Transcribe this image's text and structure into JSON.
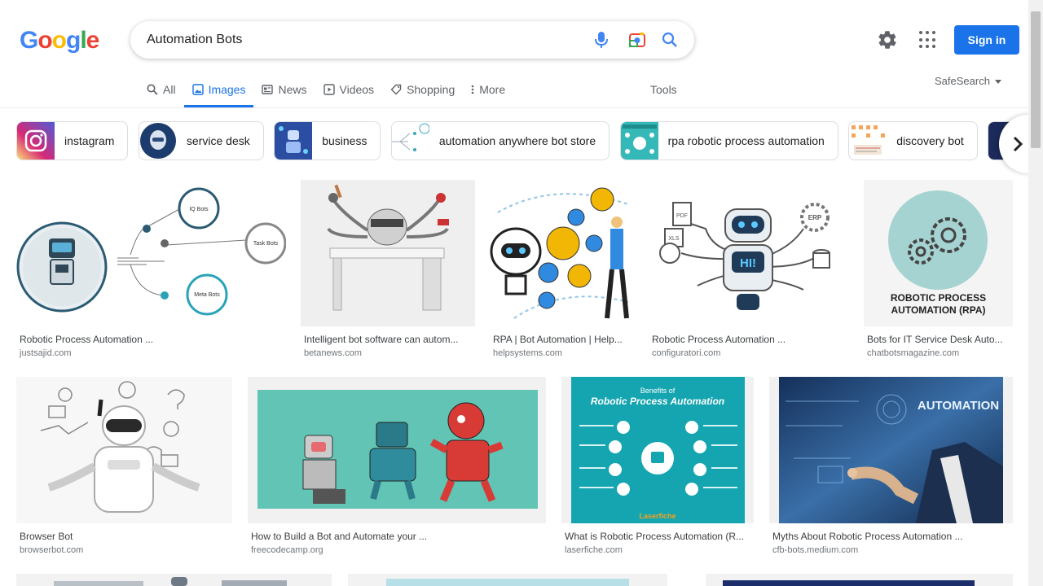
{
  "logo": {
    "letters": [
      "G",
      "o",
      "o",
      "g",
      "l",
      "e"
    ],
    "colors": [
      "#4285F4",
      "#EA4335",
      "#FBBC05",
      "#4285F4",
      "#34A853",
      "#EA4335"
    ]
  },
  "search": {
    "query": "Automation Bots"
  },
  "header": {
    "sign_in": "Sign in"
  },
  "tabs": [
    {
      "label": "All",
      "icon": "search-icon"
    },
    {
      "label": "Images",
      "icon": "image-icon",
      "active": true
    },
    {
      "label": "News",
      "icon": "news-icon"
    },
    {
      "label": "Videos",
      "icon": "video-icon"
    },
    {
      "label": "Shopping",
      "icon": "tag-icon"
    },
    {
      "label": "More",
      "icon": "more-vert-icon"
    }
  ],
  "tools_label": "Tools",
  "safesearch_label": "SafeSearch",
  "chips": [
    {
      "label": "instagram",
      "color": "#c13584"
    },
    {
      "label": "service desk",
      "color": "#1d3c6e"
    },
    {
      "label": "business",
      "color": "#2b4ea3"
    },
    {
      "label": "automation anywhere bot store",
      "color": "#e6f2f8"
    },
    {
      "label": "rpa robotic process automation",
      "color": "#34b8b8"
    },
    {
      "label": "discovery bot",
      "color": "#f4e6d6"
    },
    {
      "label": "",
      "color": "#1b2a5a"
    }
  ],
  "results": [
    {
      "title": "Robotic Process Automation ...",
      "source": "justsajid.com",
      "color": "#ffffff"
    },
    {
      "title": "Intelligent bot software can autom...",
      "source": "betanews.com",
      "color": "#eeeeee"
    },
    {
      "title": "RPA | Bot Automation | Help...",
      "source": "helpsystems.com",
      "color": "#ffffff"
    },
    {
      "title": "Robotic Process Automation ...",
      "source": "configuratori.com",
      "color": "#ffffff"
    },
    {
      "title": "Bots for IT Service Desk Auto...",
      "source": "chatbotsmagazine.com",
      "color": "#f5f5f5"
    },
    {
      "title": "Browser Bot",
      "source": "browserbot.com",
      "color": "#f7f7f7"
    },
    {
      "title": "How to Build a Bot and Automate your ...",
      "source": "freecodecamp.org",
      "color": "#f2f2f2"
    },
    {
      "title": "What is Robotic Process Automation (R...",
      "source": "laserfiche.com",
      "color": "#f2f2f2"
    },
    {
      "title": "Myths About Robotic Process Automation ...",
      "source": "cfb-bots.medium.com",
      "color": "#f2f2f2"
    }
  ],
  "image_text": {
    "r1_iq": "IQ Bots",
    "r1_task": "Task Bots",
    "r1_meta": "Meta Bots",
    "r4_pdf": "PDF",
    "r4_xls": "XLS",
    "r4_erp": "ERP",
    "r4_hi": "HI!",
    "r5_caption": "ROBOTIC PROCESS AUTOMATION (RPA)",
    "r8_heading": "Benefits of",
    "r8_title": "Robotic Process Automation",
    "r8_brand": "Laserfiche",
    "r9_word": "AUTOMATION"
  }
}
